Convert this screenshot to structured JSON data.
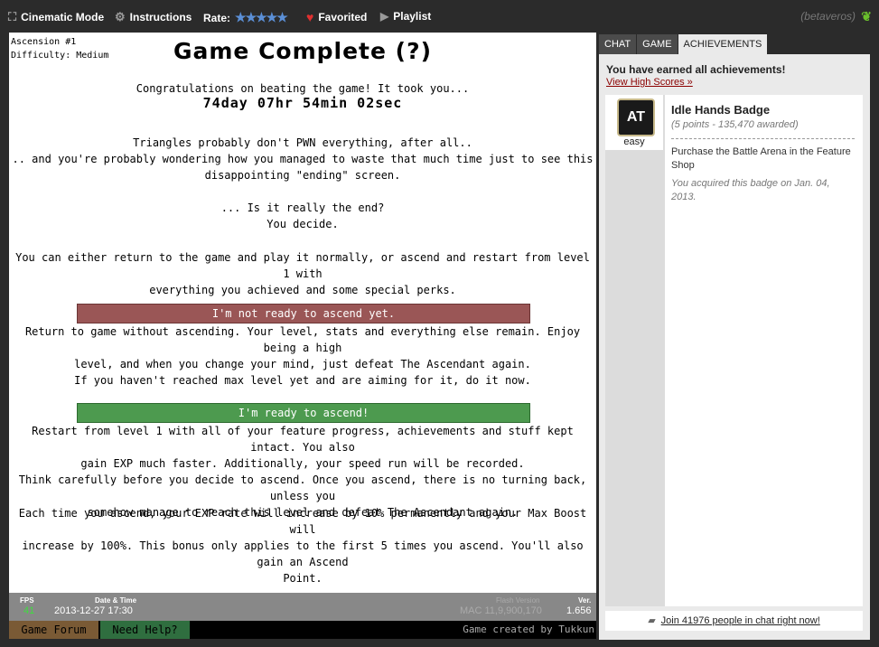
{
  "topbar": {
    "cinematic": "Cinematic Mode",
    "instructions": "Instructions",
    "rate_label": "Rate:",
    "rate_stars": "★★★★★",
    "favorited": "Favorited",
    "playlist": "Playlist",
    "username": "(betaveros)"
  },
  "game": {
    "ascension": "Ascension #1",
    "difficulty": "Difficulty: Medium",
    "title": "Game Complete (?)",
    "congrats": "Congratulations on beating the game! It took you...",
    "time": "74day 07hr 54min 02sec",
    "p1_line1": "Triangles probably don't PWN everything, after all..",
    "p1_line2": ".. and you're probably wondering how you managed to waste that much time just to see this",
    "p1_line3": "disappointing \"ending\" screen.",
    "p2_line1": "... Is it really the end?",
    "p2_line2": "You decide.",
    "p3_line1": "You can either return to the game and play it normally, or ascend and restart from level 1 with",
    "p3_line2": "everything you achieved and some special perks.",
    "not_ready_button": "I'm not ready to ascend yet.",
    "not_ready_line1": "Return to game without ascending. Your level, stats and everything else remain. Enjoy being a high",
    "not_ready_line2": "level, and when you change your mind, just defeat The Ascendant again.",
    "not_ready_line3": "If you haven't reached max level yet and are aiming for it, do it now.",
    "ready_button": "I'm ready to ascend!",
    "ready_line1": "Restart from level 1 with all of your feature progress, achievements and stuff kept intact. You also",
    "ready_line2": "gain EXP much faster. Additionally, your speed run will be recorded.",
    "ready_line3": "Think carefully before you decide to ascend. Once you ascend, there is no turning back, unless you",
    "ready_line4": "somehow manage to reach this level and defeat The Ascendant again.",
    "bonus_line1": "Each time you ascend, your EXP rate will increase by 10% permanently and your Max Boost will",
    "bonus_line2": "increase by 100%. This bonus only applies to the first 5 times you ascend. You'll also gain an Ascend",
    "bonus_line3": "Point."
  },
  "status": {
    "fps_label": "FPS",
    "fps_value": "41",
    "datetime_label": "Date & Time",
    "datetime_value": "2013-12-27 17:30",
    "flash_label": "Flash Version",
    "flash_value": "MAC 11,9,900,170",
    "ver_label": "Ver.",
    "ver_value": "1.656"
  },
  "footer": {
    "forum": "Game Forum",
    "help": "Need Help?",
    "credit": "Game created by Tukkun"
  },
  "sidebar": {
    "tabs": [
      "CHAT",
      "GAME",
      "ACHIEVEMENTS"
    ],
    "earned": "You have earned all achievements!",
    "high_scores": "View High Scores »",
    "badge": {
      "icon_text": "AT",
      "difficulty": "easy",
      "name": "Idle Hands Badge",
      "points": "(5 points - 135,470 awarded)",
      "description": "Purchase the Battle Arena in the Feature Shop",
      "acquired": "You acquired this badge on Jan. 04, 2013."
    },
    "chat_join": "Join 41976 people in chat right now!"
  },
  "colors": {
    "not_ready": "#9a5656",
    "ready": "#4d9a4f",
    "forum_btn": "#7a5a35",
    "help_btn": "#2f6e3f",
    "fps_green": "#3fdc3f"
  },
  "icons": {
    "cinematic": "expand-icon",
    "instructions": "gear-icon",
    "favorited": "heart-icon",
    "playlist": "play-icon",
    "user": "leaf-icon",
    "chat": "speech-bubble-icon"
  }
}
